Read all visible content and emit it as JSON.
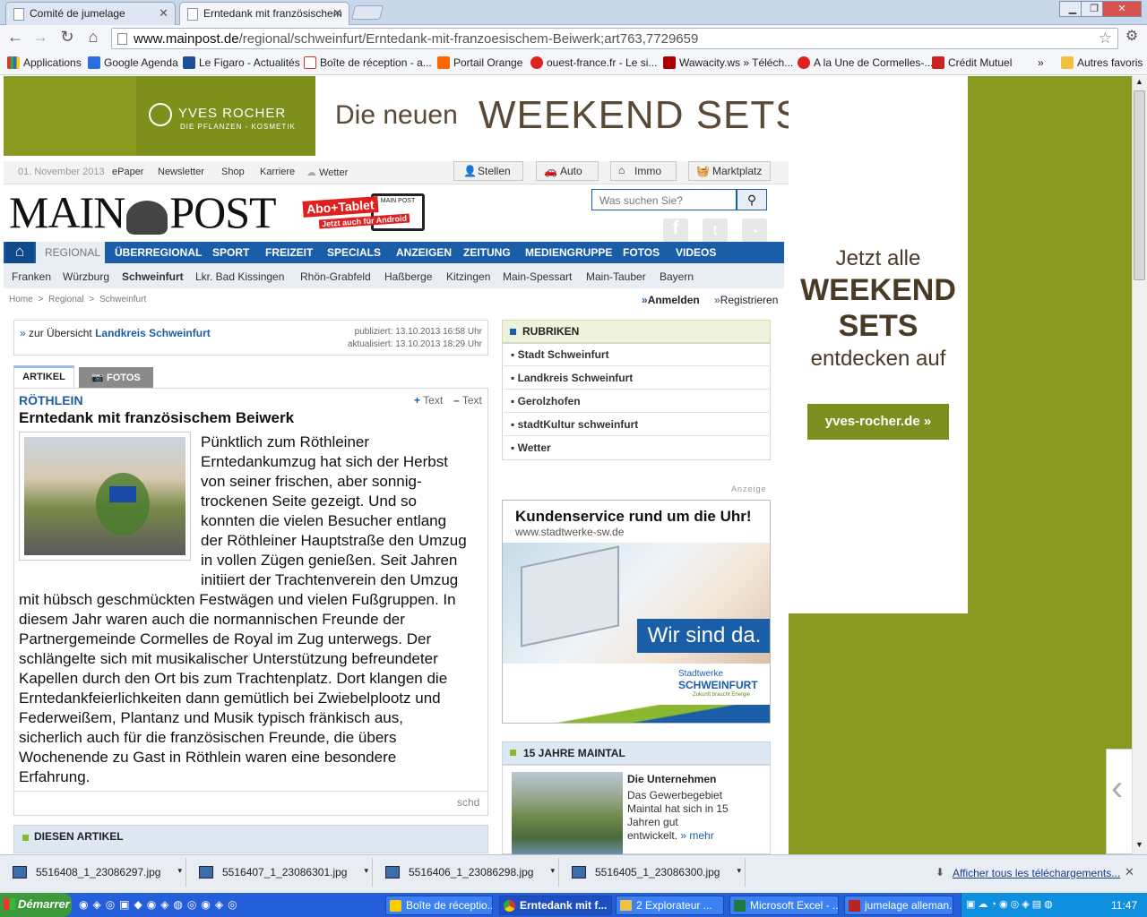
{
  "browser": {
    "tabs": [
      {
        "label": "Comité de jumelage"
      },
      {
        "label": "Erntedank mit französischem"
      }
    ],
    "url_host": "www.mainpost.de",
    "url_path": "/regional/schweinfurt/Erntedank-mit-franzoesischem-Beiwerk;art763,7729659",
    "bookmarks": [
      "Applications",
      "Google Agenda",
      "Le Figaro - Actualités",
      "Boîte de réception - a...",
      "Portail Orange",
      "ouest-france.fr - Le si...",
      "Wawacity.ws » Téléch...",
      "A la Une de Cormelles-...",
      "Crédit Mutuel",
      "»",
      "Autres favoris"
    ]
  },
  "ad_top": {
    "brand": "YVES ROCHER",
    "brand_sub": "DIE PFLANZEN - KOSMETIK",
    "headline_a": "Die neuen",
    "headline_b": "WEEKEND SETS"
  },
  "ad_side": {
    "line1": "Jetzt alle",
    "line2": "WEEKEND",
    "line3": "SETS",
    "line4": "entdecken auf",
    "button": "yves-rocher.de"
  },
  "site": {
    "date": "01. November 2013",
    "top_links": [
      "ePaper",
      "Newsletter",
      "Shop",
      "Karriere",
      "Wetter"
    ],
    "top_tabs": [
      "Stellen",
      "Auto",
      "Immo",
      "Marktplatz"
    ],
    "logo_a": "MAIN",
    "logo_b": "POST",
    "abo_a": "Abo+Tablet",
    "abo_b": "Jetzt auch für Android",
    "abo_logo": "MAIN POST",
    "search_placeholder": "Was suchen Sie?",
    "main_nav": [
      "REGIONAL",
      "ÜBERREGIONAL",
      "SPORT",
      "FREIZEIT",
      "SPECIALS",
      "ANZEIGEN",
      "ZEITUNG",
      "MEDIENGRUPPE",
      "FOTOS",
      "VIDEOS"
    ],
    "sub_nav": [
      "Franken",
      "Würzburg",
      "Schweinfurt",
      "Lkr. Bad Kissingen",
      "Rhön-Grabfeld",
      "Haßberge",
      "Kitzingen",
      "Main-Spessart",
      "Main-Tauber",
      "Bayern"
    ],
    "breadcrumb": [
      "Home",
      ">",
      "Regional",
      ">",
      "Schweinfurt"
    ],
    "login": "Anmelden",
    "register": "Registrieren"
  },
  "article": {
    "back_prefix": "zur Übersicht",
    "back_link": "Landkreis Schweinfurt",
    "published": "publiziert: 13.10.2013 16:58 Uhr",
    "updated": "aktualisiert: 13.10.2013 18:29 Uhr",
    "tab_article": "ARTIKEL",
    "tab_photos": "FOTOS",
    "text_plus": "Text",
    "text_minus": "Text",
    "kicker": "RÖTHLEIN",
    "title": "Erntedank mit französischem Beiwerk",
    "lines_wrapped": [
      "Pünktlich zum Röthleiner",
      "Erntedankumzug hat sich der Herbst",
      "von seiner frischen, aber sonnig-",
      "trockenen Seite gezeigt. Und so",
      "konnten die vielen Besucher entlang",
      "der Röthleiner Hauptstraße den Umzug",
      "in vollen Zügen genießen. Seit Jahren",
      "initiiert der Trachtenverein den Umzug"
    ],
    "lines_full": [
      "mit hübsch geschmückten Festwägen und vielen Fußgruppen. In",
      "diesem Jahr waren auch die normannischen Freunde der",
      "Partnergemeinde Cormelles de Royal im Zug unterwegs. Der",
      "schlängelte sich mit musikalischer Unterstützung befreundeter",
      "Kapellen durch den Ort bis zum Trachtenplatz. Dort klangen die",
      "Erntedankfeierlichkeiten dann gemütlich bei Zwiebelplootz und",
      "Federweißem, Plantanz und Musik typisch fränkisch aus,",
      "sicherlich auch für die französischen Freunde, die übers",
      "Wochenende zu Gast in Röthlein waren eine besondere",
      "Erfahrung."
    ],
    "author": "schd",
    "section_bottom": "DIESEN ARTIKEL"
  },
  "sidebar": {
    "rubriken_title": "RUBRIKEN",
    "rubriken": [
      "Stadt Schweinfurt",
      "Landkreis Schweinfurt",
      "Gerolzhofen",
      "stadtKultur schweinfurt",
      "Wetter"
    ],
    "anzeige": "Anzeige",
    "ad_head": "Kundenservice rund um die Uhr!",
    "ad_url": "www.stadtwerke-sw.de",
    "ad_claim": "Wir sind da.",
    "ad_logo_a": "Stadtwerke",
    "ad_logo_b": "SCHWEINFURT",
    "ad_logo_c": "Zukunft braucht Energie",
    "maintal_title": "15 JAHRE MAINTAL",
    "maintal_head": "Die Unternehmen",
    "maintal_text": [
      "Das Gewerbegebiet",
      "Maintal hat sich in 15",
      "Jahren gut",
      "entwickelt."
    ],
    "maintal_more": "» mehr"
  },
  "downloads": {
    "files": [
      "5516408_1_23086297.jpg",
      "5516407_1_23086301.jpg",
      "5516406_1_23086298.jpg",
      "5516405_1_23086300.jpg"
    ],
    "show_all": "Afficher tous les téléchargements..."
  },
  "taskbar": {
    "start": "Démarrer",
    "items": [
      "Boîte de réceptio...",
      "Erntedank mit f...",
      "2 Explorateur ...",
      "Microsoft Excel - ...",
      "jumelage alleman..."
    ],
    "clock": "11:47"
  },
  "colors": {
    "nav_blue": "#1a5ea8",
    "olive": "#8a9a21",
    "link_blue": "#1a5ea8"
  }
}
